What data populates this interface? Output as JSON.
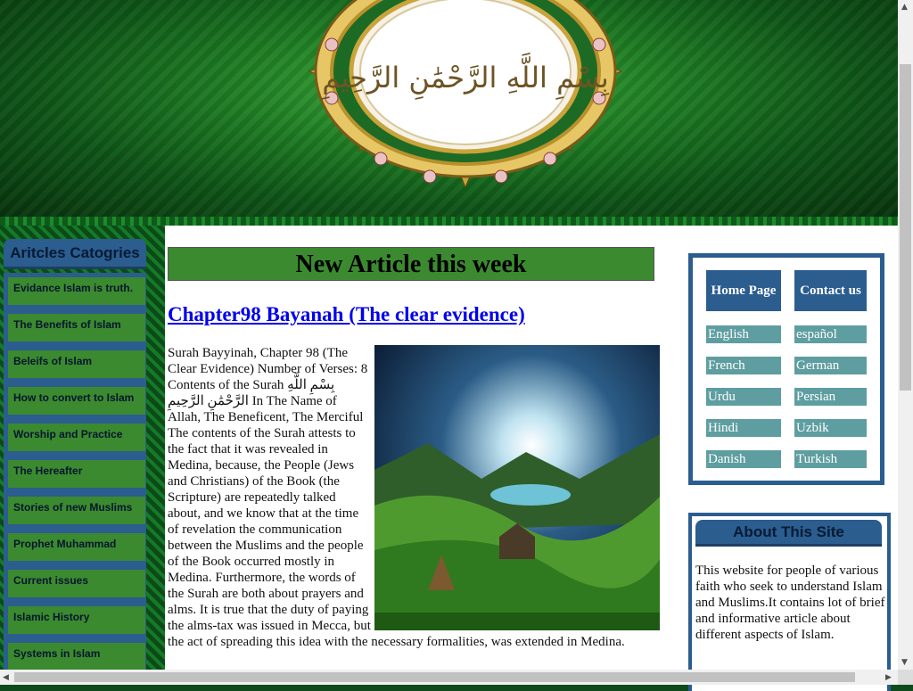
{
  "banner": {
    "calligraphy": "بِسْمِ اللَّهِ الرَّحْمَٰنِ الرَّحِيمِ",
    "colors": {
      "green_dark": "#08330d",
      "green_light": "#3fae3a",
      "gold": "#c9a43a"
    }
  },
  "sidebar": {
    "heading": "Aritcles Catogries",
    "items": [
      {
        "label": "Evidance Islam is truth."
      },
      {
        "label": "The Benefits of Islam"
      },
      {
        "label": "Beleifs of Islam"
      },
      {
        "label": "How to convert to Islam"
      },
      {
        "label": "Worship and Practice"
      },
      {
        "label": "The Hereafter"
      },
      {
        "label": "Stories of new Muslims"
      },
      {
        "label": "Prophet Muhammad"
      },
      {
        "label": "Current issues"
      },
      {
        "label": "Islamic History"
      },
      {
        "label": "Systems in Islam"
      }
    ]
  },
  "main": {
    "new_article_heading": "New Article this week",
    "article_title": "Chapter98 Bayanah (The clear evidence)",
    "article_body": "Surah Bayyinah, Chapter 98 (The Clear Evidence) Number of Verses: 8 Contents of the Surah بِسْمِ اللَّهِ الرَّحْمَٰنِ الرَّحِيمِ In The Name of Allah, The Beneficent, The Merciful The contents of the Surah attests to the fact that it was revealed in Medina, because, the People (Jews and Christians) of the Book (the Scripture) are repeatedly talked about, and we know that at the time of revelation the communication between the Muslims and the people of the Book occurred mostly in Medina. Furthermore, the words of the Surah are both about prayers and alms. It is true that the duty of paying the alms-tax was issued in Mecca, but the act of spreading this idea with the necessary formalities, was extended in Medina."
  },
  "right": {
    "home_button": "Home Page",
    "contact_button": "Contact us",
    "languages": [
      "English",
      "español",
      "French",
      "German",
      "Urdu",
      "Persian",
      "Hindi",
      "Uzbik",
      "Danish",
      "Turkish"
    ],
    "about_heading": "About This Site",
    "about_text": "This website for people of various faith who seek to understand Islam and Muslims.It contains lot of brief and informative article about different aspects of Islam."
  },
  "colors": {
    "nav_blue": "#2b5d8f",
    "nav_green": "#3b8a2f",
    "lang_teal": "#5f9ea0"
  }
}
